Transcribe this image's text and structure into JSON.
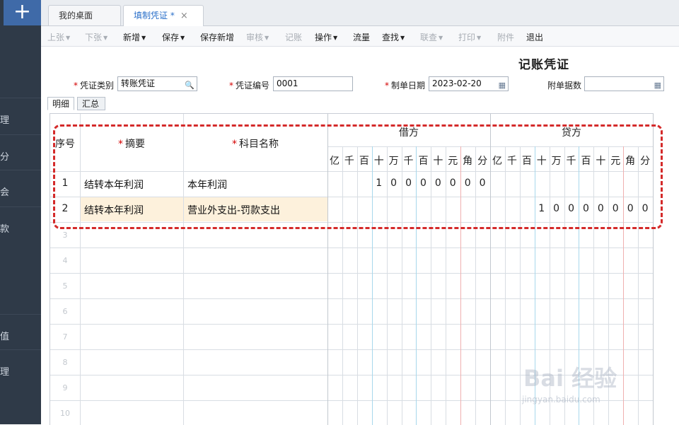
{
  "sidebar": {
    "add_label": "+",
    "items": [
      "理",
      "分",
      "会",
      "款",
      "值",
      "理"
    ]
  },
  "tabs": [
    {
      "label": "我的桌面"
    },
    {
      "label": "填制凭证 *",
      "close": "×"
    }
  ],
  "toolbar": {
    "prev": "上张",
    "next": "下张",
    "add": "新增",
    "save": "保存",
    "save_new": "保存新增",
    "audit": "审核",
    "post": "记账",
    "operate": "操作",
    "flow": "流量",
    "find": "查找",
    "link": "联查",
    "print": "打印",
    "attach": "附件",
    "exit": "退出"
  },
  "header": {
    "title": "记账凭证",
    "type_label": "凭证类别",
    "type_value": "转账凭证",
    "no_label": "凭证编号",
    "no_value": "0001",
    "date_label": "制单日期",
    "date_value": "2023-02-20",
    "attach_label": "附单据数",
    "attach_value": "",
    "required_mark": "*"
  },
  "subtabs": {
    "detail": "明细",
    "summary": "汇总"
  },
  "grid": {
    "seq_header": "序号",
    "summary_header": "摘要",
    "account_header": "科目名称",
    "debit_header": "借方",
    "credit_header": "贷方",
    "digit_units": [
      "亿",
      "千",
      "百",
      "十",
      "万",
      "千",
      "百",
      "十",
      "元",
      "角",
      "分"
    ],
    "rows": [
      {
        "no": "1",
        "summary": "结转本年利润",
        "account": "本年利润",
        "debit": "10000000",
        "credit": ""
      },
      {
        "no": "2",
        "summary": "结转本年利润",
        "account": "营业外支出-罚款支出",
        "debit": "",
        "credit": "10000000"
      }
    ],
    "empty_rows": [
      "3",
      "4",
      "5",
      "6",
      "7",
      "8",
      "9",
      "10"
    ]
  },
  "watermark": {
    "main": "Bai 经验",
    "sub": "jingyan.baidu.com"
  },
  "colors": {
    "sidebar": "#2f3a48",
    "accent": "#3f6aa8",
    "highlight": "#fdf1dc",
    "annotation": "#d42a2a"
  }
}
